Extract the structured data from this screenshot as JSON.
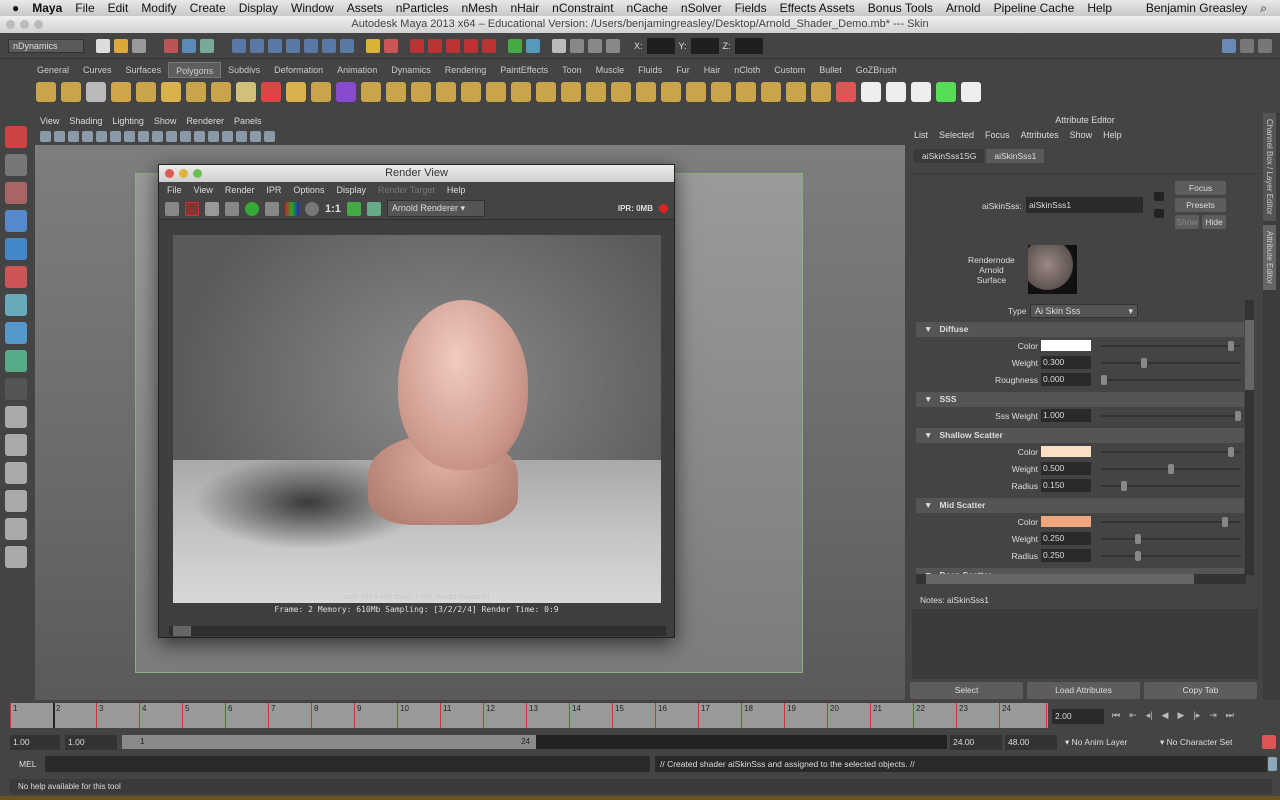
{
  "mac_menu": {
    "apple": "",
    "items": [
      "Maya",
      "File",
      "Edit",
      "Modify",
      "Create",
      "Display",
      "Window",
      "Assets",
      "nParticles",
      "nMesh",
      "nHair",
      "nConstraint",
      "nCache",
      "nSolver",
      "Fields",
      "Effects Assets",
      "Bonus Tools",
      "Arnold",
      "Pipeline Cache",
      "Help"
    ],
    "user": "Benjamin Greasley"
  },
  "window_title": "Autodesk Maya 2013 x64 – Educational Version: /Users/benjamingreasley/Desktop/Arnold_Shader_Demo.mb*  ---  Skin",
  "status_line": {
    "menu_set": "nDynamics",
    "x_label": "X:",
    "y_label": "Y:",
    "z_label": "Z:"
  },
  "shelf_tabs": [
    "General",
    "Curves",
    "Surfaces",
    "Polygons",
    "Subdivs",
    "Deformation",
    "Animation",
    "Dynamics",
    "Rendering",
    "PaintEffects",
    "Toon",
    "Muscle",
    "Fluids",
    "Fur",
    "Hair",
    "nCloth",
    "Custom",
    "Bullet",
    "GoZBrush"
  ],
  "shelf_active": "Polygons",
  "panel_menu": [
    "View",
    "Shading",
    "Lighting",
    "Show",
    "Renderer",
    "Panels"
  ],
  "render_view": {
    "title": "Render View",
    "menu": [
      "File",
      "View",
      "Render",
      "IPR",
      "Options",
      "Display",
      "Render Target",
      "Help"
    ],
    "ratio": "1:1",
    "renderer": "Arnold Renderer",
    "ipr": "IPR: 0MB",
    "image_info": "size: 640 x 480  zoom: 1.000    [Arnold Renderer]",
    "status": "Frame: 2   Memory: 610Mb   Sampling: [3/2/2/4]   Render Time: 0:9"
  },
  "attribute_editor": {
    "title": "Attribute Editor",
    "menu": [
      "List",
      "Selected",
      "Focus",
      "Attributes",
      "Show",
      "Help"
    ],
    "tabs": [
      "aiSkinSss1SG",
      "aiSkinSss1"
    ],
    "node_label": "aiSkinSss:",
    "node_name": "aiSkinSss1",
    "focus": "Focus",
    "presets": "Presets",
    "show": "Show",
    "hide": "Hide",
    "swatch_label": [
      "Rendernode",
      "Arnold",
      "Surface"
    ],
    "type_label": "Type",
    "type_value": "Ai Skin Sss",
    "sections": [
      {
        "title": "Diffuse",
        "rows": [
          {
            "label": "Color",
            "color": "#ffffff",
            "slider": 0.95
          },
          {
            "label": "Weight",
            "value": "0.300",
            "slider": 0.3
          },
          {
            "label": "Roughness",
            "value": "0.000",
            "slider": 0.0
          }
        ]
      },
      {
        "title": "SSS",
        "rows": [
          {
            "label": "Sss Weight",
            "value": "1.000",
            "slider": 1.0
          }
        ]
      },
      {
        "title": "Shallow Scatter",
        "rows": [
          {
            "label": "Color",
            "color": "#fde0c2",
            "slider": 0.95
          },
          {
            "label": "Weight",
            "value": "0.500",
            "slider": 0.5
          },
          {
            "label": "Radius",
            "value": "0.150",
            "slider": 0.15
          }
        ]
      },
      {
        "title": "Mid Scatter",
        "rows": [
          {
            "label": "Color",
            "color": "#f0a77f",
            "slider": 0.9
          },
          {
            "label": "Weight",
            "value": "0.250",
            "slider": 0.25
          },
          {
            "label": "Radius",
            "value": "0.250",
            "slider": 0.25
          }
        ]
      },
      {
        "title": "Deep Scatter",
        "rows": []
      }
    ],
    "notes": "Notes:  aiSkinSss1",
    "buttons": [
      "Select",
      "Load Attributes",
      "Copy Tab"
    ],
    "side_tabs": [
      "Channel Box / Layer Editor",
      "Attribute Editor"
    ]
  },
  "timeline": {
    "frames": [
      "1",
      "2",
      "3",
      "4",
      "5",
      "6",
      "7",
      "8",
      "9",
      "10",
      "11",
      "12",
      "13",
      "14",
      "15",
      "16",
      "17",
      "18",
      "19",
      "20",
      "21",
      "22",
      "23",
      "24"
    ],
    "current_frame": "2.00"
  },
  "range": {
    "start": "1.00",
    "start2": "1.00",
    "min": "1",
    "max": "24",
    "end": "24.00",
    "end2": "48.00",
    "anim_layer": "No Anim Layer",
    "char_set": "No Character Set"
  },
  "command": {
    "label": "MEL",
    "output": "// Created shader aiSkinSss and assigned to the selected objects. //"
  },
  "help_line": "No help available for this tool"
}
